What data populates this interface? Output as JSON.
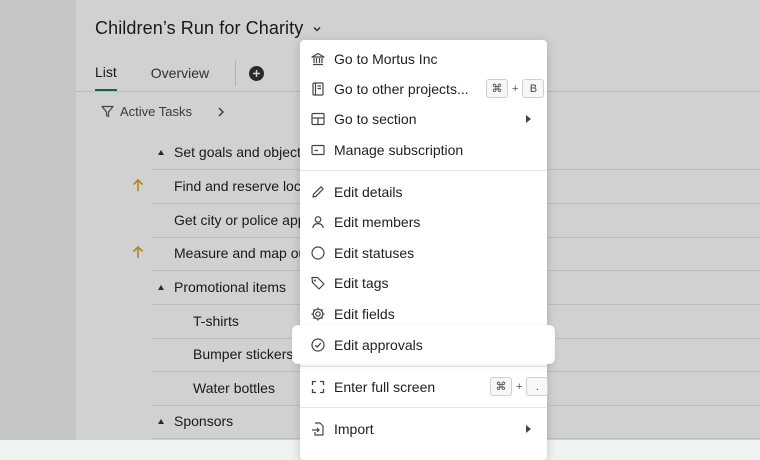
{
  "project": {
    "title": "Children’s Run for Charity"
  },
  "tabs": [
    {
      "label": "List"
    },
    {
      "label": "Overview"
    }
  ],
  "filter": {
    "label": "Active Tasks"
  },
  "tasks": [
    {
      "label": "Set goals and objectives"
    },
    {
      "label": "Find and reserve location"
    },
    {
      "label": "Get city or police approval"
    },
    {
      "label": "Measure and map out route"
    },
    {
      "label": "Promotional items"
    },
    {
      "label": "T-shirts"
    },
    {
      "label": "Bumper stickers"
    },
    {
      "label": "Water bottles"
    },
    {
      "label": "Sponsors"
    }
  ],
  "menu": {
    "items": [
      {
        "label": "Go to Mortus Inc",
        "icon": "bank-icon"
      },
      {
        "label": "Go to other projects...",
        "icon": "notebook-icon",
        "shortcut": [
          "⌘",
          "+",
          "B"
        ]
      },
      {
        "label": "Go to section",
        "icon": "layout-icon"
      },
      {
        "label": "Manage subscription",
        "icon": "card-icon"
      },
      {
        "label": "Edit details",
        "icon": "pencil-icon"
      },
      {
        "label": "Edit members",
        "icon": "person-icon"
      },
      {
        "label": "Edit statuses",
        "icon": "circle-icon"
      },
      {
        "label": "Edit tags",
        "icon": "tag-icon"
      },
      {
        "label": "Edit fields",
        "icon": "gear-icon"
      },
      {
        "label": "Edit approvals",
        "icon": "check-circle-icon"
      },
      {
        "label": "Enter full screen",
        "icon": "fullscreen-icon",
        "shortcut": [
          "⌘",
          "+",
          "."
        ]
      },
      {
        "label": "Import",
        "icon": "import-icon"
      }
    ]
  },
  "colors": {
    "accent": "#1f7a4d",
    "priority": "#e0a12b"
  }
}
